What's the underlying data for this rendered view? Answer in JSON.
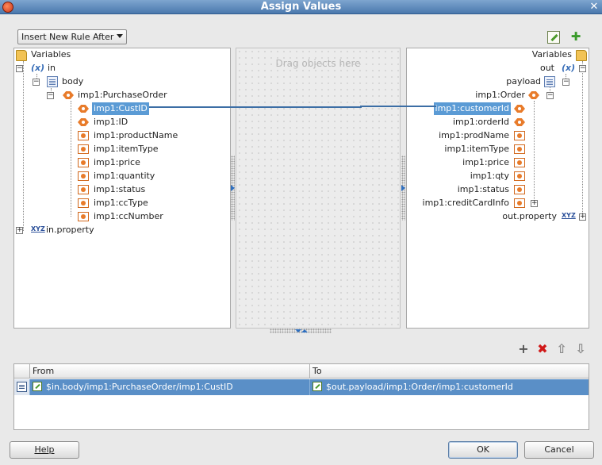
{
  "window": {
    "title": "Assign Values",
    "close_glyph": "✕"
  },
  "toolbar": {
    "insert_mode": "Insert New Rule After",
    "edit_icon": "edit-expression-icon",
    "puzzle_icon": "xpath-function-icon"
  },
  "source_tree": {
    "root": "Variables",
    "var_glyph": "(x)",
    "in": "in",
    "body": "body",
    "purchase_order": "imp1:PurchaseOrder",
    "fields": [
      "imp1:CustID",
      "imp1:ID",
      "imp1:productName",
      "imp1:itemType",
      "imp1:price",
      "imp1:quantity",
      "imp1:status",
      "imp1:ccType",
      "imp1:ccNumber"
    ],
    "in_property": "in.property",
    "xyz_glyph": "XYZ"
  },
  "middle": {
    "drag_hint": "Drag objects here"
  },
  "target_tree": {
    "root": "Variables",
    "var_glyph": "(x)",
    "out": "out",
    "payload": "payload",
    "order": "imp1:Order",
    "fields": [
      "imp1:customerId",
      "imp1:orderId",
      "imp1:prodName",
      "imp1:itemType",
      "imp1:price",
      "imp1:qty",
      "imp1:status",
      "imp1:creditCardInfo"
    ],
    "out_property": "out.property",
    "xyz_glyph": "XYZ"
  },
  "actions": {
    "add": "+",
    "delete": "✖",
    "up": "⇧",
    "down": "⇩"
  },
  "rules_table": {
    "headers": {
      "from": "From",
      "to": "To"
    },
    "rows": [
      {
        "from": "$in.body/imp1:PurchaseOrder/imp1:CustID",
        "to": "$out.payload/imp1:Order/imp1:customerId"
      }
    ]
  },
  "buttons": {
    "help": "Help",
    "ok": "OK",
    "cancel": "Cancel"
  },
  "colors": {
    "selection": "#5b9bd5",
    "mapping_line": "#3c6ea5",
    "title_bar": "#4a78ad"
  }
}
